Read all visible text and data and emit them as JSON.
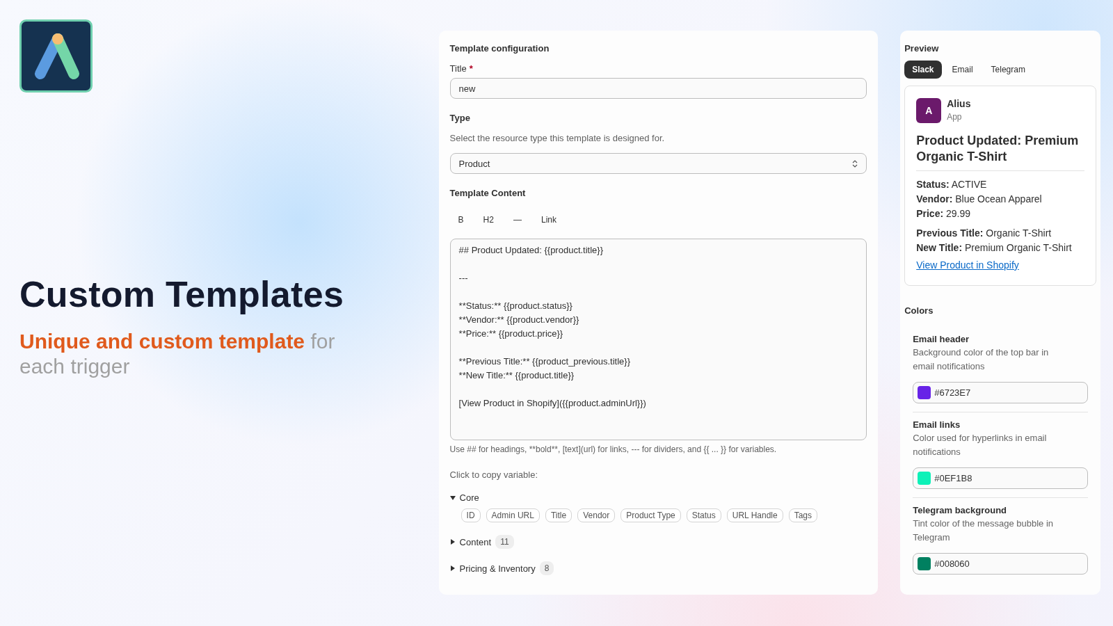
{
  "hero": {
    "title": "Custom Templates",
    "subtitle_highlight": "Unique and custom template",
    "subtitle_rest": "for each trigger"
  },
  "config": {
    "heading": "Template configuration",
    "title_field": {
      "label": "Title",
      "required_mark": "*",
      "value": "new"
    },
    "type_section": {
      "heading": "Type",
      "description": "Select the resource type this template is designed for.",
      "value": "Product"
    },
    "content_section": {
      "heading": "Template Content",
      "toolbar": [
        "B",
        "H2",
        "—",
        "Link"
      ],
      "value": "## Product Updated: {{product.title}}\n\n---\n\n**Status:** {{product.status}}\n**Vendor:** {{product.vendor}}\n**Price:** {{product.price}}\n\n**Previous Title:** {{product_previous.title}}\n**New Title:** {{product.title}}\n\n[View Product in Shopify]({{product.adminUrl}})",
      "help": "Use ## for headings, **bold**, [text](url) for links, --- for dividers, and {{ ... }} for variables."
    },
    "variables": {
      "label": "Click to copy variable:",
      "groups": [
        {
          "name": "Core",
          "expanded": true,
          "chips": [
            "ID",
            "Admin URL",
            "Title",
            "Vendor",
            "Product Type",
            "Status",
            "URL Handle",
            "Tags"
          ]
        },
        {
          "name": "Content",
          "expanded": false,
          "count": "11"
        },
        {
          "name": "Pricing & Inventory",
          "expanded": false,
          "count": "8"
        }
      ]
    }
  },
  "preview": {
    "heading": "Preview",
    "tabs": [
      {
        "label": "Slack",
        "selected": true
      },
      {
        "label": "Email",
        "selected": false
      },
      {
        "label": "Telegram",
        "selected": false
      }
    ],
    "message": {
      "avatar": "A",
      "sender": "Alius",
      "sender_role": "App",
      "title": "Product Updated: Premium Organic T-Shirt",
      "field_groups": [
        [
          {
            "label": "Status:",
            "value": "ACTIVE"
          },
          {
            "label": "Vendor:",
            "value": "Blue Ocean Apparel"
          },
          {
            "label": "Price:",
            "value": "29.99"
          }
        ],
        [
          {
            "label": "Previous Title:",
            "value": "Organic T-Shirt"
          },
          {
            "label": "New Title:",
            "value": "Premium Organic T-Shirt"
          }
        ]
      ],
      "link": "View Product in Shopify"
    }
  },
  "colors": {
    "heading": "Colors",
    "items": [
      {
        "name": "Email header",
        "description": "Background color of the top bar in email notifications",
        "value": "#6723E7",
        "color": "#6723e7"
      },
      {
        "name": "Email links",
        "description": "Color used for hyperlinks in email notifications",
        "value": "#0EF1B8",
        "color": "#0ef1b8"
      },
      {
        "name": "Telegram background",
        "description": "Tint color of the message bubble in Telegram",
        "value": "#008060",
        "color": "#008060"
      }
    ]
  }
}
